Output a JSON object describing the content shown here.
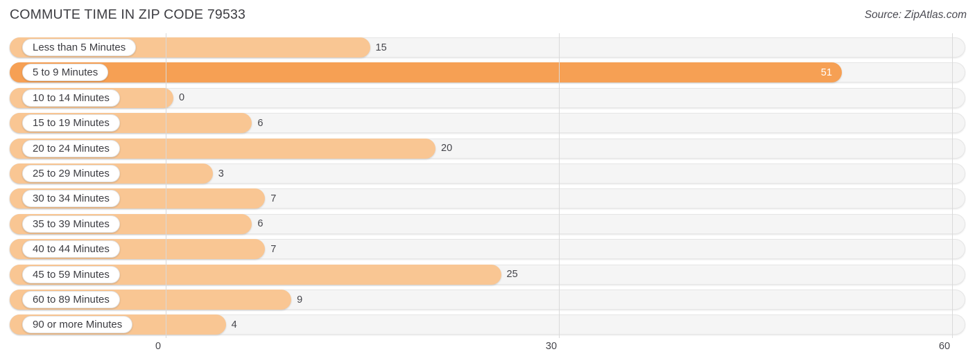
{
  "header": {
    "title": "COMMUTE TIME IN ZIP CODE 79533",
    "source": "Source: ZipAtlas.com"
  },
  "colors": {
    "bar": "#f9c693",
    "bar_highlight": "#f6a054",
    "track": "#f5f5f5",
    "gridline": "#d9d9d9",
    "text": "#3c3c41"
  },
  "chart_data": {
    "type": "bar",
    "orientation": "horizontal",
    "title": "COMMUTE TIME IN ZIP CODE 79533",
    "xlabel": "",
    "ylabel": "",
    "xlim": [
      0,
      60
    ],
    "xticks": [
      0,
      30,
      60
    ],
    "xtick_labels": [
      "0",
      "30",
      "60"
    ],
    "grid": true,
    "legend": null,
    "categories": [
      "Less than 5 Minutes",
      "5 to 9 Minutes",
      "10 to 14 Minutes",
      "15 to 19 Minutes",
      "20 to 24 Minutes",
      "25 to 29 Minutes",
      "30 to 34 Minutes",
      "35 to 39 Minutes",
      "40 to 44 Minutes",
      "45 to 59 Minutes",
      "60 to 89 Minutes",
      "90 or more Minutes"
    ],
    "values": [
      15,
      51,
      0,
      6,
      20,
      3,
      7,
      6,
      7,
      25,
      9,
      4
    ],
    "value_labels": [
      "15",
      "51",
      "0",
      "6",
      "20",
      "3",
      "7",
      "6",
      "7",
      "25",
      "9",
      "4"
    ],
    "highlighted_index": 1
  }
}
